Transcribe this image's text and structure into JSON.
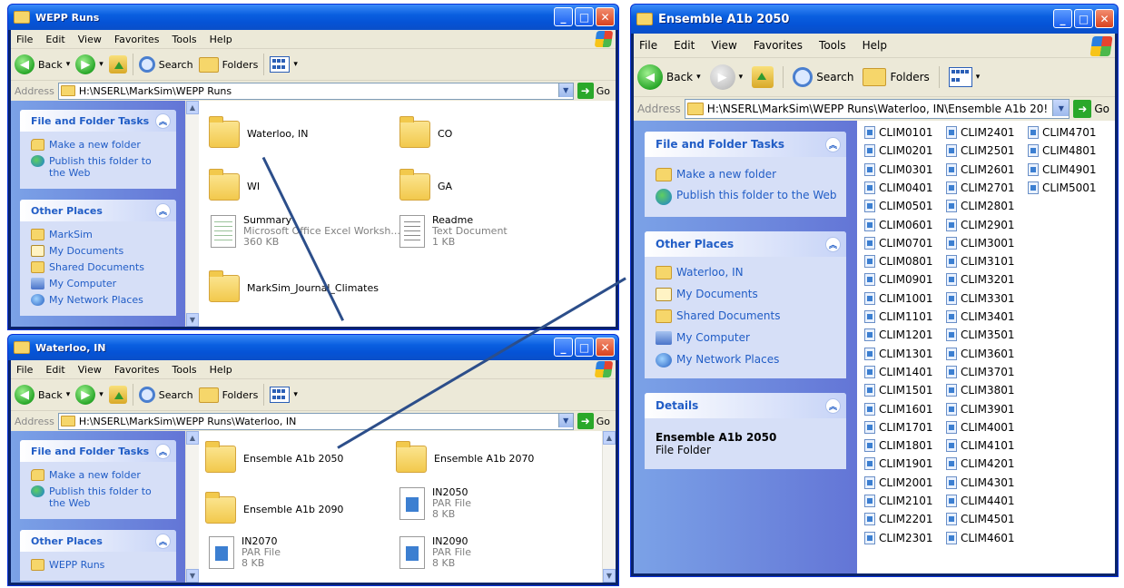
{
  "menu": [
    "File",
    "Edit",
    "View",
    "Favorites",
    "Tools",
    "Help"
  ],
  "toolbar": {
    "back": "Back",
    "search": "Search",
    "folders": "Folders"
  },
  "address_label": "Address",
  "go_label": "Go",
  "panel_titles": {
    "tasks": "File and Folder Tasks",
    "places": "Other Places",
    "details": "Details"
  },
  "tasks": {
    "new_folder": "Make a new folder",
    "publish": "Publish this folder to the Web"
  },
  "common_places": {
    "my_documents": "My Documents",
    "shared": "Shared Documents",
    "my_computer": "My Computer",
    "network": "My Network Places"
  },
  "win1": {
    "title": "WEPP Runs",
    "address": "H:\\NSERL\\MarkSim\\WEPP Runs",
    "places_first": "MarkSim",
    "items": {
      "waterloo": "Waterloo, IN",
      "co": "CO",
      "wi": "WI",
      "ga": "GA",
      "summary_name": "Summary",
      "summary_type": "Microsoft Office Excel Worksh...",
      "summary_size": "360 KB",
      "readme_name": "Readme",
      "readme_type": "Text Document",
      "readme_size": "1 KB",
      "journal": "MarkSim_Journal_Climates"
    }
  },
  "win2": {
    "title": "Waterloo, IN",
    "address": "H:\\NSERL\\MarkSim\\WEPP Runs\\Waterloo, IN",
    "places_first": "WEPP Runs",
    "items": {
      "e2050": "Ensemble A1b 2050",
      "e2070": "Ensemble A1b 2070",
      "e2090": "Ensemble A1b 2090",
      "in2050": "IN2050",
      "in2070": "IN2070",
      "in2090": "IN2090",
      "par": "PAR File",
      "kb8": "8 KB"
    }
  },
  "win3": {
    "title": "Ensemble A1b 2050",
    "address": "H:\\NSERL\\MarkSim\\WEPP Runs\\Waterloo, IN\\Ensemble A1b 20!",
    "places_first": "Waterloo, IN",
    "details_name": "Ensemble A1b 2050",
    "details_type": "File Folder",
    "files_col1": [
      "CLIM0101",
      "CLIM0201",
      "CLIM0301",
      "CLIM0401",
      "CLIM0501",
      "CLIM0601",
      "CLIM0701",
      "CLIM0801",
      "CLIM0901",
      "CLIM1001",
      "CLIM1101",
      "CLIM1201",
      "CLIM1301",
      "CLIM1401",
      "CLIM1501",
      "CLIM1601",
      "CLIM1701",
      "CLIM1801",
      "CLIM1901",
      "CLIM2001",
      "CLIM2101",
      "CLIM2201",
      "CLIM2301"
    ],
    "files_col2": [
      "CLIM2401",
      "CLIM2501",
      "CLIM2601",
      "CLIM2701",
      "CLIM2801",
      "CLIM2901",
      "CLIM3001",
      "CLIM3101",
      "CLIM3201",
      "CLIM3301",
      "CLIM3401",
      "CLIM3501",
      "CLIM3601",
      "CLIM3701",
      "CLIM3801",
      "CLIM3901",
      "CLIM4001",
      "CLIM4101",
      "CLIM4201",
      "CLIM4301",
      "CLIM4401",
      "CLIM4501",
      "CLIM4601"
    ],
    "files_col3": [
      "CLIM4701",
      "CLIM4801",
      "CLIM4901",
      "CLIM5001"
    ]
  }
}
